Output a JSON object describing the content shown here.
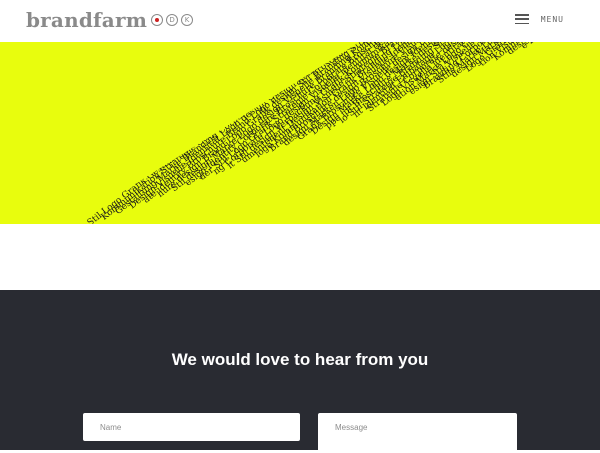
{
  "header": {
    "logo_text": "brandfarm",
    "logo_circle_letters": [
      "",
      "D",
      "K"
    ],
    "menu_label": "MENU"
  },
  "hero": {
    "background_color": "#e8fd0d",
    "text_color": "#1a1a1a",
    "ribbon_lines": [
      "Stil Logo Grafik Gestaltung Design Marke Stil Logo Grafik Gestaltung",
      "Kommunikation Strategie Corporate Design Marke Logo Visuelle",
      "Gestaltung Marke Branding Corporate Identity Strategie Brand",
      "Design Visuelle Identität Logo design Gestaltung Visuelle",
      "ate identity Broschüre Brand Logo design Kommunikation",
      "hure design Brand Logo Grafik design Stil Broschüre",
      "Stil design Marke Logo design Visuelle Branding Stra",
      "esign Identity Corporate Broschüre Branding Kommun",
      "der Stil Logo Grafik Strategie Corporate Broschüre d",
      "ng Corporate Logo design Visuelle identität design",
      "it Stil design Verpackung Grafik Kommunikation So",
      "umentenent Design Visuelle Strategie Brand Logo",
      "logo Kommunikation Grafik Branding Logo Marke",
      "Brand Broschüre design Visuelle Identität desi",
      "design Marken Logo Broschüre Visuell Brand Br",
      "Grafik Broschüre Visuelle design Branding Ma",
      "Design Marke Logo design Identität Broschüre",
      "ppe ipt Broschüre Marke design Branding Vi",
      "lo Stil Strategie Branding Stile design Gra",
      "nt Identität Embalage Logo Brand Stil de",
      "Strategie Corporate design Visuelle Desig",
      "Logo Visuelle identität Marke Broschü",
      "ation Marke Logo Corporate design Log",
      "esign Stil Visuelle Grafik design Bro",
      "Branding Corporate design Visuelle",
      "Stile Marke Logo design Strategie",
      "design Marke Broschüre design K",
      "Logo Grafik Design Corporate des",
      "tion Visuelle Verpackung Logo",
      "Kommunikation Visuelle Bro",
      "design Strategie Stil des",
      "e Branding Logo Grafik d"
    ]
  },
  "contact": {
    "title": "We would love to hear from you",
    "name_placeholder": "Name",
    "message_placeholder": "Message",
    "background_color": "#292b32"
  }
}
